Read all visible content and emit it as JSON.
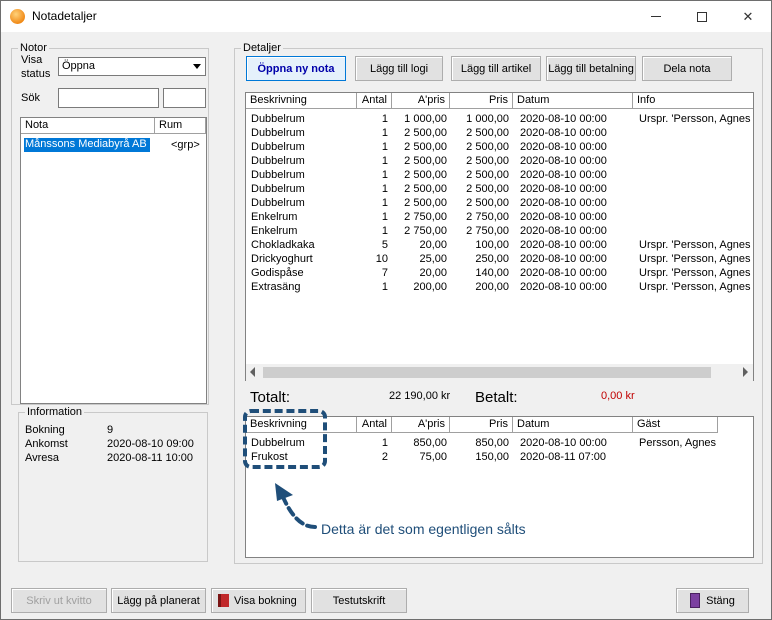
{
  "window": {
    "title": "Notadetaljer"
  },
  "notor": {
    "legend": "Notor",
    "visa_status_label_1": "Visa",
    "visa_status_label_2": "status",
    "status_value": "Öppna",
    "sok_label": "Sök",
    "list_headers": [
      "Nota",
      "Rum"
    ],
    "rows": [
      {
        "nota": "Månssons Mediabyrå AB",
        "rum": "<grp>"
      }
    ]
  },
  "information": {
    "legend": "Information",
    "rows": [
      {
        "label": "Bokning",
        "value": "9"
      },
      {
        "label": "Ankomst",
        "value": "2020-08-10 09:00"
      },
      {
        "label": "Avresa",
        "value": "2020-08-11 10:00"
      }
    ]
  },
  "detaljer": {
    "legend": "Detaljer",
    "buttons": [
      "Öppna ny nota",
      "Lägg till logi",
      "Lägg till artikel",
      "Lägg till betalning",
      "Dela nota"
    ],
    "headers": [
      "Beskrivning",
      "Antal",
      "A'pris",
      "Pris",
      "Datum",
      "Info"
    ],
    "rows": [
      [
        "Dubbelrum",
        "1",
        "1 000,00",
        "1 000,00",
        "2020-08-10 00:00",
        "Urspr. 'Persson, Agnes ("
      ],
      [
        "Dubbelrum",
        "1",
        "2 500,00",
        "2 500,00",
        "2020-08-10 00:00",
        ""
      ],
      [
        "Dubbelrum",
        "1",
        "2 500,00",
        "2 500,00",
        "2020-08-10 00:00",
        ""
      ],
      [
        "Dubbelrum",
        "1",
        "2 500,00",
        "2 500,00",
        "2020-08-10 00:00",
        ""
      ],
      [
        "Dubbelrum",
        "1",
        "2 500,00",
        "2 500,00",
        "2020-08-10 00:00",
        ""
      ],
      [
        "Dubbelrum",
        "1",
        "2 500,00",
        "2 500,00",
        "2020-08-10 00:00",
        ""
      ],
      [
        "Dubbelrum",
        "1",
        "2 500,00",
        "2 500,00",
        "2020-08-10 00:00",
        ""
      ],
      [
        "Enkelrum",
        "1",
        "2 750,00",
        "2 750,00",
        "2020-08-10 00:00",
        ""
      ],
      [
        "Enkelrum",
        "1",
        "2 750,00",
        "2 750,00",
        "2020-08-10 00:00",
        ""
      ],
      [
        "Chokladkaka",
        "5",
        "20,00",
        "100,00",
        "2020-08-10 00:00",
        "Urspr. 'Persson, Agnes ("
      ],
      [
        "Drickyoghurt",
        "10",
        "25,00",
        "250,00",
        "2020-08-10 00:00",
        "Urspr. 'Persson, Agnes ("
      ],
      [
        "Godispåse",
        "7",
        "20,00",
        "140,00",
        "2020-08-10 00:00",
        "Urspr. 'Persson, Agnes ("
      ],
      [
        "Extrasäng",
        "1",
        "200,00",
        "200,00",
        "2020-08-10 00:00",
        "Urspr. 'Persson, Agnes ("
      ]
    ],
    "totalt_label": "Totalt:",
    "totalt_value": "22 190,00 kr",
    "betalt_label": "Betalt:",
    "betalt_value": "0,00 kr",
    "sold_headers": [
      "Beskrivning",
      "Antal",
      "A'pris",
      "Pris",
      "Datum",
      "Gäst"
    ],
    "sold_rows": [
      [
        "Dubbelrum",
        "1",
        "850,00",
        "850,00",
        "2020-08-10 00:00",
        "Persson, Agnes"
      ],
      [
        "Frukost",
        "2",
        "75,00",
        "150,00",
        "2020-08-11 07:00",
        ""
      ]
    ]
  },
  "footer": {
    "buttons": [
      "Skriv ut kvitto",
      "Lägg på planerat",
      "Visa bokning",
      "Testutskrift",
      "Stäng"
    ]
  },
  "annotation": {
    "text": "Detta är det som egentligen sålts"
  },
  "colors": {
    "selection": "#0078d7",
    "betalt": "#c00000",
    "annotation": "#1f4e79",
    "primary_text": "#0000aa"
  }
}
